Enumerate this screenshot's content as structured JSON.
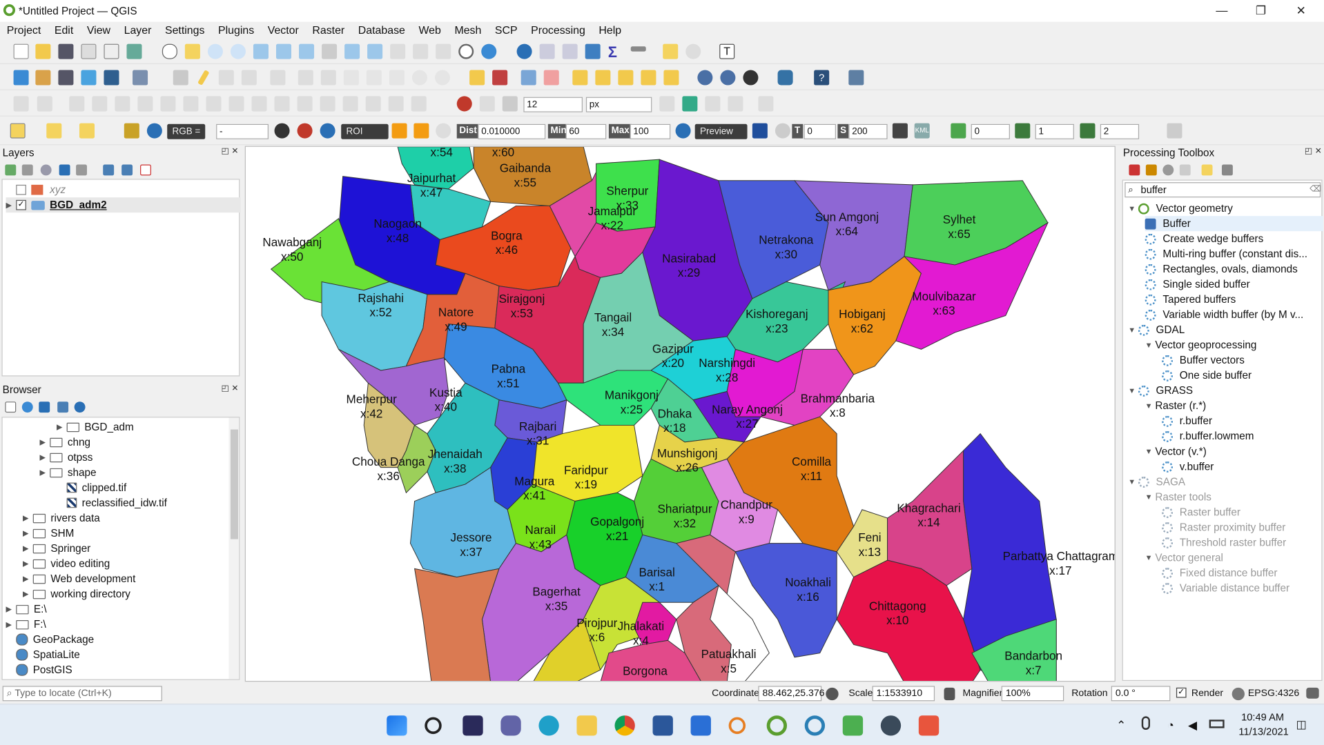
{
  "window": {
    "title": "*Untitled Project — QGIS",
    "min": "—",
    "max": "❐",
    "close": "✕"
  },
  "menu": [
    "Project",
    "Edit",
    "View",
    "Layer",
    "Settings",
    "Plugins",
    "Vector",
    "Raster",
    "Database",
    "Web",
    "Mesh",
    "SCP",
    "Processing",
    "Help"
  ],
  "toolbar": {
    "font_size": "12",
    "font_unit": "px",
    "rgb_label": "RGB =",
    "rgb_value": "-",
    "roi_label": "ROI",
    "dist_label": "Dist",
    "dist_value": "0.010000",
    "min_label": "Min",
    "min_value": "60",
    "max_label": "Max",
    "max_value": "100",
    "preview_label": "Preview",
    "t_label": "T",
    "t_value": "0",
    "s_label": "S",
    "s_value": "200",
    "kml_label": "KML",
    "v1": "0",
    "v2": "1",
    "v3": "2"
  },
  "layers": {
    "title": "Layers",
    "items": [
      {
        "name": "xyz",
        "checked": false
      },
      {
        "name": "BGD_adm2",
        "checked": true
      }
    ]
  },
  "browser": {
    "title": "Browser",
    "items": [
      {
        "label": "BGD_adm",
        "indent": 3,
        "type": "folder"
      },
      {
        "label": "chng",
        "indent": 2,
        "type": "folder"
      },
      {
        "label": "otpss",
        "indent": 2,
        "type": "folder"
      },
      {
        "label": "shape",
        "indent": 2,
        "type": "folder"
      },
      {
        "label": "clipped.tif",
        "indent": 3,
        "type": "raster"
      },
      {
        "label": "reclassified_idw.tif",
        "indent": 3,
        "type": "raster"
      },
      {
        "label": "rivers data",
        "indent": 1,
        "type": "folder"
      },
      {
        "label": "SHM",
        "indent": 1,
        "type": "folder"
      },
      {
        "label": "Springer",
        "indent": 1,
        "type": "folder"
      },
      {
        "label": "video editing",
        "indent": 1,
        "type": "folder"
      },
      {
        "label": "Web development",
        "indent": 1,
        "type": "folder"
      },
      {
        "label": "working directory",
        "indent": 1,
        "type": "folder"
      },
      {
        "label": "E:\\",
        "indent": 0,
        "type": "drive"
      },
      {
        "label": "F:\\",
        "indent": 0,
        "type": "drive"
      },
      {
        "label": "GeoPackage",
        "indent": 0,
        "type": "db"
      },
      {
        "label": "SpatiaLite",
        "indent": 0,
        "type": "db"
      },
      {
        "label": "PostGIS",
        "indent": 0,
        "type": "db"
      }
    ]
  },
  "processing": {
    "title": "Processing Toolbox",
    "search": "buffer",
    "items": [
      {
        "label": "Vector geometry",
        "level": 0,
        "kind": "group"
      },
      {
        "label": "Buffer",
        "level": 1,
        "kind": "algo",
        "selected": true
      },
      {
        "label": "Create wedge buffers",
        "level": 1,
        "kind": "algo"
      },
      {
        "label": "Multi-ring buffer (constant dis...",
        "level": 1,
        "kind": "algo"
      },
      {
        "label": "Rectangles, ovals, diamonds",
        "level": 1,
        "kind": "algo"
      },
      {
        "label": "Single sided buffer",
        "level": 1,
        "kind": "algo"
      },
      {
        "label": "Tapered buffers",
        "level": 1,
        "kind": "algo"
      },
      {
        "label": "Variable width buffer (by M v...",
        "level": 1,
        "kind": "algo"
      },
      {
        "label": "GDAL",
        "level": 0,
        "kind": "group"
      },
      {
        "label": "Vector geoprocessing",
        "level": 1,
        "kind": "sub"
      },
      {
        "label": "Buffer vectors",
        "level": 2,
        "kind": "algo"
      },
      {
        "label": "One side buffer",
        "level": 2,
        "kind": "algo"
      },
      {
        "label": "GRASS",
        "level": 0,
        "kind": "group"
      },
      {
        "label": "Raster (r.*)",
        "level": 1,
        "kind": "sub"
      },
      {
        "label": "r.buffer",
        "level": 2,
        "kind": "algo"
      },
      {
        "label": "r.buffer.lowmem",
        "level": 2,
        "kind": "algo"
      },
      {
        "label": "Vector (v.*)",
        "level": 1,
        "kind": "sub"
      },
      {
        "label": "v.buffer",
        "level": 2,
        "kind": "algo"
      },
      {
        "label": "SAGA",
        "level": 0,
        "kind": "group",
        "disabled": true
      },
      {
        "label": "Raster tools",
        "level": 1,
        "kind": "sub",
        "disabled": true
      },
      {
        "label": "Raster buffer",
        "level": 2,
        "kind": "algo",
        "disabled": true
      },
      {
        "label": "Raster proximity buffer",
        "level": 2,
        "kind": "algo",
        "disabled": true
      },
      {
        "label": "Threshold raster buffer",
        "level": 2,
        "kind": "algo",
        "disabled": true
      },
      {
        "label": "Vector general",
        "level": 1,
        "kind": "sub",
        "disabled": true
      },
      {
        "label": "Fixed distance buffer",
        "level": 2,
        "kind": "algo",
        "disabled": true
      },
      {
        "label": "Variable distance buffer",
        "level": 2,
        "kind": "algo",
        "disabled": true
      }
    ]
  },
  "map_labels": [
    {
      "name": "",
      "x": "x:54"
    },
    {
      "name": "",
      "x": "x:60"
    },
    {
      "name": "Gaibanda",
      "x": "x:55"
    },
    {
      "name": "Jaipurhat",
      "x": "x:47"
    },
    {
      "name": "Sherpur",
      "x": "x:33"
    },
    {
      "name": "Jamalpur",
      "x": "x:22"
    },
    {
      "name": "Naogaon",
      "x": "x:48"
    },
    {
      "name": "Bogra",
      "x": "x:46"
    },
    {
      "name": "Nawabganj",
      "x": "x:50"
    },
    {
      "name": "Netrakona",
      "x": "x:30"
    },
    {
      "name": "Sun Amgonj",
      "x": "x:64"
    },
    {
      "name": "Sylhet",
      "x": "x:65"
    },
    {
      "name": "Nasirabad",
      "x": "x:29"
    },
    {
      "name": "Rajshahi",
      "x": "x:52"
    },
    {
      "name": "Natore",
      "x": "x:49"
    },
    {
      "name": "Sirajgonj",
      "x": "x:53"
    },
    {
      "name": "Tangail",
      "x": "x:34"
    },
    {
      "name": "Kishoreganj",
      "x": "x:23"
    },
    {
      "name": "Hobiganj",
      "x": "x:62"
    },
    {
      "name": "Moulvibazar",
      "x": "x:63"
    },
    {
      "name": "Pabna",
      "x": "x:51"
    },
    {
      "name": "Gazipur",
      "x": "x:20"
    },
    {
      "name": "Narshingdi",
      "x": "x:28"
    },
    {
      "name": "Meherpur",
      "x": "x:42"
    },
    {
      "name": "Kustia",
      "x": "x:40"
    },
    {
      "name": "Manikgonj",
      "x": "x:25"
    },
    {
      "name": "Dhaka",
      "x": "x:18"
    },
    {
      "name": "Naray Angonj",
      "x": "x:27"
    },
    {
      "name": "Brahmanbaria",
      "x": "x:8"
    },
    {
      "name": "Rajbari",
      "x": "x:31"
    },
    {
      "name": "Choua Danga",
      "x": "x:36"
    },
    {
      "name": "Jhenaidah",
      "x": "x:38"
    },
    {
      "name": "Munshigonj",
      "x": "x:26"
    },
    {
      "name": "Comilla",
      "x": "x:11"
    },
    {
      "name": "Magura",
      "x": "x:41"
    },
    {
      "name": "Faridpur",
      "x": "x:19"
    },
    {
      "name": "Shariatpur",
      "x": "x:32"
    },
    {
      "name": "Chandpur",
      "x": "x:9"
    },
    {
      "name": "Khagrachari",
      "x": "x:14"
    },
    {
      "name": "Jessore",
      "x": "x:37"
    },
    {
      "name": "Narail",
      "x": "x:43"
    },
    {
      "name": "Gopalgonj",
      "x": "x:21"
    },
    {
      "name": "Feni",
      "x": "x:13"
    },
    {
      "name": "Parbattya Chattagram",
      "x": "x:17"
    },
    {
      "name": "Barisal",
      "x": "x:1"
    },
    {
      "name": "Noakhali",
      "x": "x:16"
    },
    {
      "name": "Bagerhat",
      "x": "x:35"
    },
    {
      "name": "Chittagong",
      "x": "x:10"
    },
    {
      "name": "Pirojpur",
      "x": "x:6"
    },
    {
      "name": "Jhalakati",
      "x": "x:4"
    },
    {
      "name": "Patuakhali",
      "x": "x:5"
    },
    {
      "name": "Bandarbon",
      "x": "x:7"
    },
    {
      "name": "Borgona",
      "x": ""
    }
  ],
  "status": {
    "locate_placeholder": "Type to locate (Ctrl+K)",
    "coordinate_label": "Coordinate",
    "coordinate": "88.462,25.376",
    "scale_label": "Scale",
    "scale": "1:1533910",
    "magnifier_label": "Magnifier",
    "magnifier": "100%",
    "rotation_label": "Rotation",
    "rotation": "0.0 °",
    "render_label": "Render",
    "crs": "EPSG:4326"
  },
  "taskbar": {
    "time": "10:49 AM",
    "date": "11/13/2021"
  }
}
